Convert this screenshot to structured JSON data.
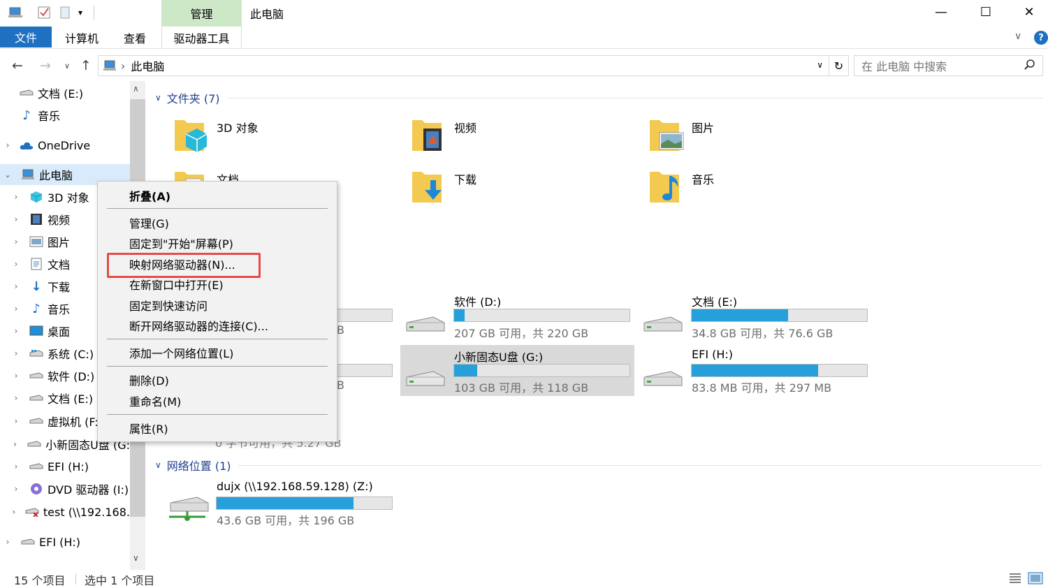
{
  "window": {
    "title": "此电脑",
    "manage_tab": "管理",
    "minimize": "—",
    "maximize": "☐",
    "close": "✕"
  },
  "ribbon": {
    "tabs": [
      "文件",
      "计算机",
      "查看",
      "驱动器工具"
    ]
  },
  "address": {
    "path_label": "此电脑",
    "separator": "›",
    "search_placeholder": "在 此电脑 中搜索"
  },
  "nav": {
    "items": [
      {
        "label": "文档 (E:)"
      },
      {
        "label": "音乐"
      },
      {
        "label": "OneDrive"
      },
      {
        "label": "此电脑"
      },
      {
        "label": "3D 对象"
      },
      {
        "label": "视频"
      },
      {
        "label": "图片"
      },
      {
        "label": "文档"
      },
      {
        "label": "下载"
      },
      {
        "label": "音乐"
      },
      {
        "label": "桌面"
      },
      {
        "label": "系统 (C:)"
      },
      {
        "label": "软件 (D:)"
      },
      {
        "label": "文档 (E:)"
      },
      {
        "label": "虚拟机 (F:"
      },
      {
        "label": "小新固态U盘 (G:"
      },
      {
        "label": "EFI (H:)"
      },
      {
        "label": "DVD 驱动器 (I:)"
      },
      {
        "label": "test (\\\\192.168."
      },
      {
        "label": "EFI (H:)"
      }
    ]
  },
  "content": {
    "folders_group": "文件夹 (7)",
    "folders": [
      "3D 对象",
      "视频",
      "图片",
      "文档",
      "下载",
      "音乐"
    ],
    "drives": [
      {
        "name": "软件 (D:)",
        "free": "207 GB 可用，共 220 GB",
        "used_fraction": 0.06
      },
      {
        "name": "文档 (E:)",
        "free": "34.8 GB 可用，共 76.6 GB",
        "used_fraction": 0.55
      },
      {
        "name": "小新固态U盘 (G:)",
        "free": "103 GB 可用，共 118 GB",
        "used_fraction": 0.13
      },
      {
        "name": "EFI (H:)",
        "free": "83.8 MB 可用，共 297 MB",
        "used_fraction": 0.72
      }
    ],
    "partial_left_1": "B",
    "partial_left_2": "B",
    "partial_bottom": "0 字节可用，共 5.27 GB",
    "network_group": "网络位置 (1)",
    "network": {
      "name": "dujx (\\\\192.168.59.128) (Z:)",
      "free": "43.6 GB 可用，共 196 GB",
      "used_fraction": 0.78
    }
  },
  "context_menu": {
    "collapse": "折叠(A)",
    "manage": "管理(G)",
    "pin_start": "固定到\"开始\"屏幕(P)",
    "map_drive": "映射网络驱动器(N)...",
    "open_new": "在新窗口中打开(E)",
    "pin_quick": "固定到快速访问",
    "disconnect": "断开网络驱动器的连接(C)...",
    "add_location": "添加一个网络位置(L)",
    "delete": "删除(D)",
    "rename": "重命名(M)",
    "properties": "属性(R)"
  },
  "status": {
    "count": "15 个项目",
    "selected": "选中 1 个项目"
  },
  "colors": {
    "accent": "#1e70c0",
    "bar_fill": "#26a0da",
    "highlight": "#e84a48"
  }
}
